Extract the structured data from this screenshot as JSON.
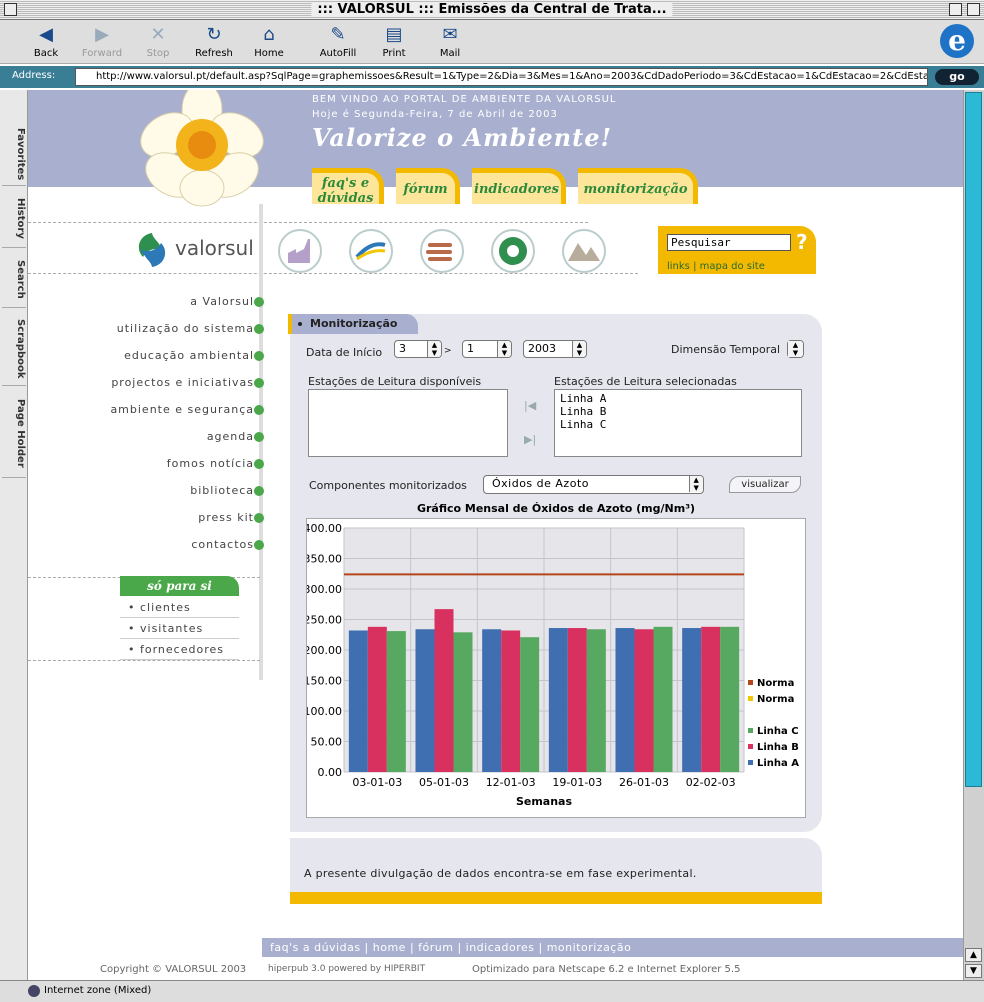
{
  "window": {
    "title": "::: VALORSUL ::: Emissões da Central de Trata..."
  },
  "toolbar": {
    "back": "Back",
    "forward": "Forward",
    "stop": "Stop",
    "refresh": "Refresh",
    "home": "Home",
    "autofill": "AutoFill",
    "print": "Print",
    "mail": "Mail"
  },
  "address": {
    "label": "Address:",
    "url": "http://www.valorsul.pt/default.asp?SqlPage=graphemissoes&Result=1&Type=2&Dia=3&Mes=1&Ano=2003&CdDadoPeriodo=3&CdEstacao=1&CdEstacao=2&CdEstacao=3&CdPoluente",
    "go": "go"
  },
  "sidetabs": [
    "Favorites",
    "History",
    "Search",
    "Scrapbook",
    "Page Holder"
  ],
  "header": {
    "welcome": "BEM VINDO AO PORTAL DE AMBIENTE DA VALORSUL",
    "date": "Hoje é Segunda-Feira, 7 de Abril de 2003",
    "slogan": "Valorize o Ambiente!",
    "tabs": [
      "faq's e dúvidas",
      "fórum",
      "indicadores",
      "monitorização"
    ]
  },
  "logo": {
    "text": "valorsul"
  },
  "search": {
    "placeholder": "Pesquisar",
    "links": "links | mapa do site"
  },
  "menu": [
    "a Valorsul",
    "utilização do sistema",
    "educação ambiental",
    "projectos e iniciativas",
    "ambiente e segurança",
    "agenda",
    "fomos notícia",
    "biblioteca",
    "press kit",
    "contactos"
  ],
  "soparasi": {
    "title": "só para si",
    "items": [
      "clientes",
      "visitantes",
      "fornecedores"
    ]
  },
  "panel": {
    "title": "Monitorização",
    "data_inicio_label": "Data de Início",
    "day": "3",
    "month": "1",
    "year": "2003",
    "dimensao_label": "Dimensão Temporal",
    "disponiveis_label": "Estações de Leitura disponíveis",
    "selecionadas_label": "Estações de Leitura selecionadas",
    "selecionadas": [
      "Linha A",
      "Linha B",
      "Linha C"
    ],
    "componentes_label": "Componentes monitorizados",
    "componente": "Óxidos de Azoto",
    "visualizar": "visualizar"
  },
  "chart_data": {
    "type": "bar",
    "title": "Gráfico Mensal de Óxidos de Azoto (mg/Nm³)",
    "xlabel": "Semanas",
    "ylabel": "",
    "categories": [
      "03-01-03",
      "05-01-03",
      "12-01-03",
      "19-01-03",
      "26-01-03",
      "02-02-03"
    ],
    "ylim": [
      0,
      400
    ],
    "yticks": [
      "0.00",
      "50.00",
      "100.00",
      "150.00",
      "200.00",
      "250.00",
      "300.00",
      "350.00",
      "400.00"
    ],
    "series": [
      {
        "name": "Linha A",
        "color": "#3f6fb0",
        "values": [
          232,
          234,
          234,
          236,
          236,
          236
        ]
      },
      {
        "name": "Linha B",
        "color": "#d8305f",
        "values": [
          238,
          267,
          232,
          236,
          234,
          238
        ]
      },
      {
        "name": "Linha C",
        "color": "#57a860",
        "values": [
          231,
          229,
          221,
          234,
          238,
          238
        ]
      }
    ],
    "reference_lines": [
      {
        "name": "Norma",
        "color": "#b3461a",
        "value": 324
      },
      {
        "name": "Norma",
        "color": "#f2c600",
        "value": null
      }
    ],
    "legend": "right"
  },
  "notice": "A presente divulgação de dados encontra-se em fase experimental.",
  "footer": {
    "links": "faq's a dúvidas  |  home  |  fórum  |  indicadores  |  monitorização",
    "copyright": "Copyright © VALORSUL 2003",
    "powered": "hiperpub 3.0 powered by HIPERBIT",
    "optim": "Optimizado para Netscape 6.2 e Internet Explorer 5.5"
  },
  "status": "Internet zone (Mixed)"
}
